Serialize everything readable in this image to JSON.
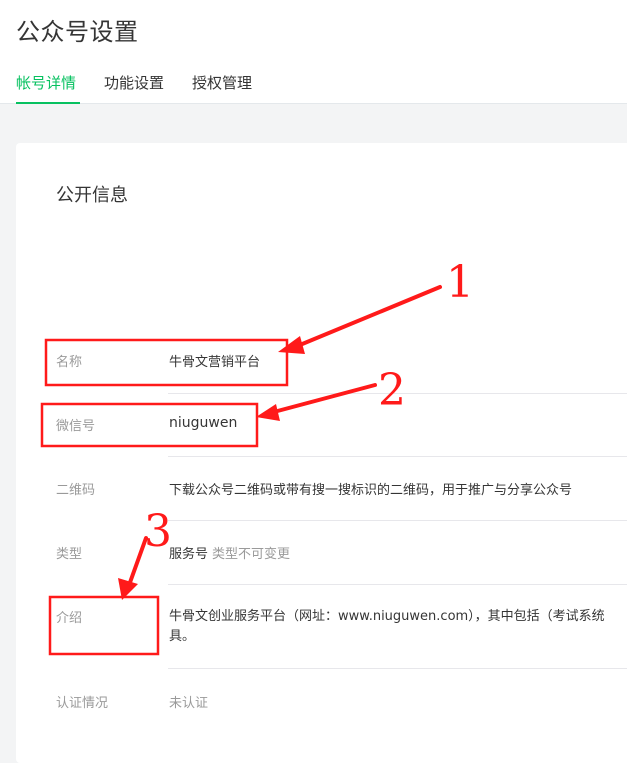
{
  "page": {
    "title": "公众号设置"
  },
  "tabs": [
    {
      "label": "帐号详情",
      "active": true
    },
    {
      "label": "功能设置",
      "active": false
    },
    {
      "label": "授权管理",
      "active": false
    }
  ],
  "public_info": {
    "title": "公开信息",
    "rows": [
      {
        "label": "名称",
        "value": "牛骨文营销平台"
      },
      {
        "label": "微信号",
        "value": "niuguwen"
      },
      {
        "label": "二维码",
        "value": "下载公众号二维码或带有搜一搜标识的二维码，用于推广与分享公众号"
      },
      {
        "label": "类型",
        "value": "服务号",
        "note": "类型不可变更"
      },
      {
        "label": "介绍",
        "value_line1": "牛骨文创业服务平台（网址：www.niuguwen.com），其中包括（考试系统",
        "value_line2": "具。"
      },
      {
        "label": "认证情况",
        "value": "未认证"
      }
    ]
  },
  "annotations": {
    "numbers": [
      "1",
      "2",
      "3"
    ],
    "color": "#ff1a1a"
  },
  "colors": {
    "accent": "#07c160",
    "text": "#353535",
    "muted": "#9a9a9a"
  }
}
